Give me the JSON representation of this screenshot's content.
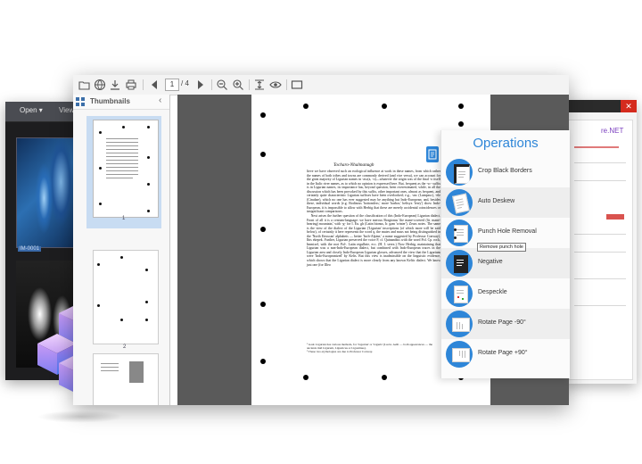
{
  "medical_window": {
    "open_label": "Open ▾",
    "view_label": "View"
  },
  "form_window": {
    "close_label": "✕",
    "logo_fragment": "re.NET"
  },
  "toolbar": {
    "icons": [
      "open-folder-icon",
      "globe-icon",
      "download-icon",
      "print-icon",
      "previous-page-icon",
      "next-page-icon",
      "zoom-out-icon",
      "zoom-in-icon",
      "fit-page-icon",
      "view-mode-icon",
      "annotation-rect-icon"
    ],
    "current_page": "1",
    "page_total": "/ 4"
  },
  "thumbnails": {
    "title": "Thumbnails",
    "collapse_icon": "chevron-left-icon",
    "pages": [
      {
        "number": "1",
        "selected": true
      },
      {
        "number": "2",
        "selected": false
      }
    ]
  },
  "document": {
    "heading": "Tocharo-Nhalmanugh",
    "body": "lieve we have observed such an ecological influence at work in these names, from which rather the names of both tribes and towns are commonly derived (and vice versa), we can account for the great majority of Ligurian names in -asc(a, -o)—whatever the origin was of the final -o itself in the Italic river names, as to which no opinion is expressed here. But, frequent as the -sc- suffix is in Ligurian names, its importance has, beyond question, been overestimated, while, in all the discussion which has been provoked by this suffix, other important ones, almost as frequent, and certainly quite characteristic Ligurian suffixes have been overlooked; e.g., -asc (Lumpasc), -ele (Cinubae), which no one has ever suggested may be anything but Indo-European; and, besides these, individual words (e.g. Bodincus 'bottomless,' more 'harbor,' helisyx 'ferry') show Indo-European, it is impossible to allow with Herbig that these are merely accidental coincidences or insignificant comparisons.\n    Next arises the further question of the classification of this (Indo-European) Ligurian dialect. Front of all it is a centum-language: we have mercus Borgionas 'the mane-covered (lit. mane-bearing) mountain,' with -g- for I. Eu. gh (Latin bionus, Ir. gam 'winter'). Zeuss notes. The same is the view of the dialect of the Ligurian ('Ligurian' inscriptions (of which more will be said below), of certainly it here represents the word q, the mutes and mass not being distinguished in the 'North Etruscan' alphabets — better 'Inch-Alpine,' a name suggested by Professor Conway). Ibis ekepek. Further, Ligurian preserved the voice P, cf. Quinandius with the word Pol. Cp. rock, Immixel, with the root Pol-. Latin regulbrie, ecc. (H. I. serex.) Now Herbig, maintaining that Ligurian was a non-Indo-European dialect, but combined with Indo-European traces in the Ligurian area and closely Indo-European Ligurian glosses, advanced the view that the Ligurians were 'Indo-Europeanized' by Kelts. But this view is inadmissible on the linguistic evidence, which shows that the Ligurian dialect is more clearly from any known Keltic dialect. We know just one (for Illeo",
    "footnotes": "¹ Gaul. Ligurian has various methods, for 'Ligurian' or 'Liguris' (Lucia. Aelii — both appearances — the ancients mid Ligurum, Ligusticus or Ligustinus).\n² These two etymologies are due to Professor Conway."
  },
  "operations": {
    "title": "Operations",
    "items": [
      {
        "label": "Crop Black Borders",
        "icon": "crop-icon"
      },
      {
        "label": "Auto Deskew",
        "icon": "deskew-icon"
      },
      {
        "label": "Punch Hole Removal",
        "icon": "punch-hole-icon"
      },
      {
        "label": "Negative",
        "icon": "negative-icon"
      },
      {
        "label": "Despeckle",
        "icon": "despeckle-icon"
      },
      {
        "label": "Rotate Page -90°",
        "icon": "rotate-ccw-icon"
      },
      {
        "label": "Rotate Page +90°",
        "icon": "rotate-cw-icon"
      }
    ],
    "tooltip": "Remove punch hole"
  },
  "colors": {
    "accent": "#2e86d8",
    "thumbnail_selected": "#c8dcf2",
    "doc_background": "#6e6e6e",
    "cube_purple": "#b48cf0",
    "cube_blue": "#4a7af0"
  }
}
